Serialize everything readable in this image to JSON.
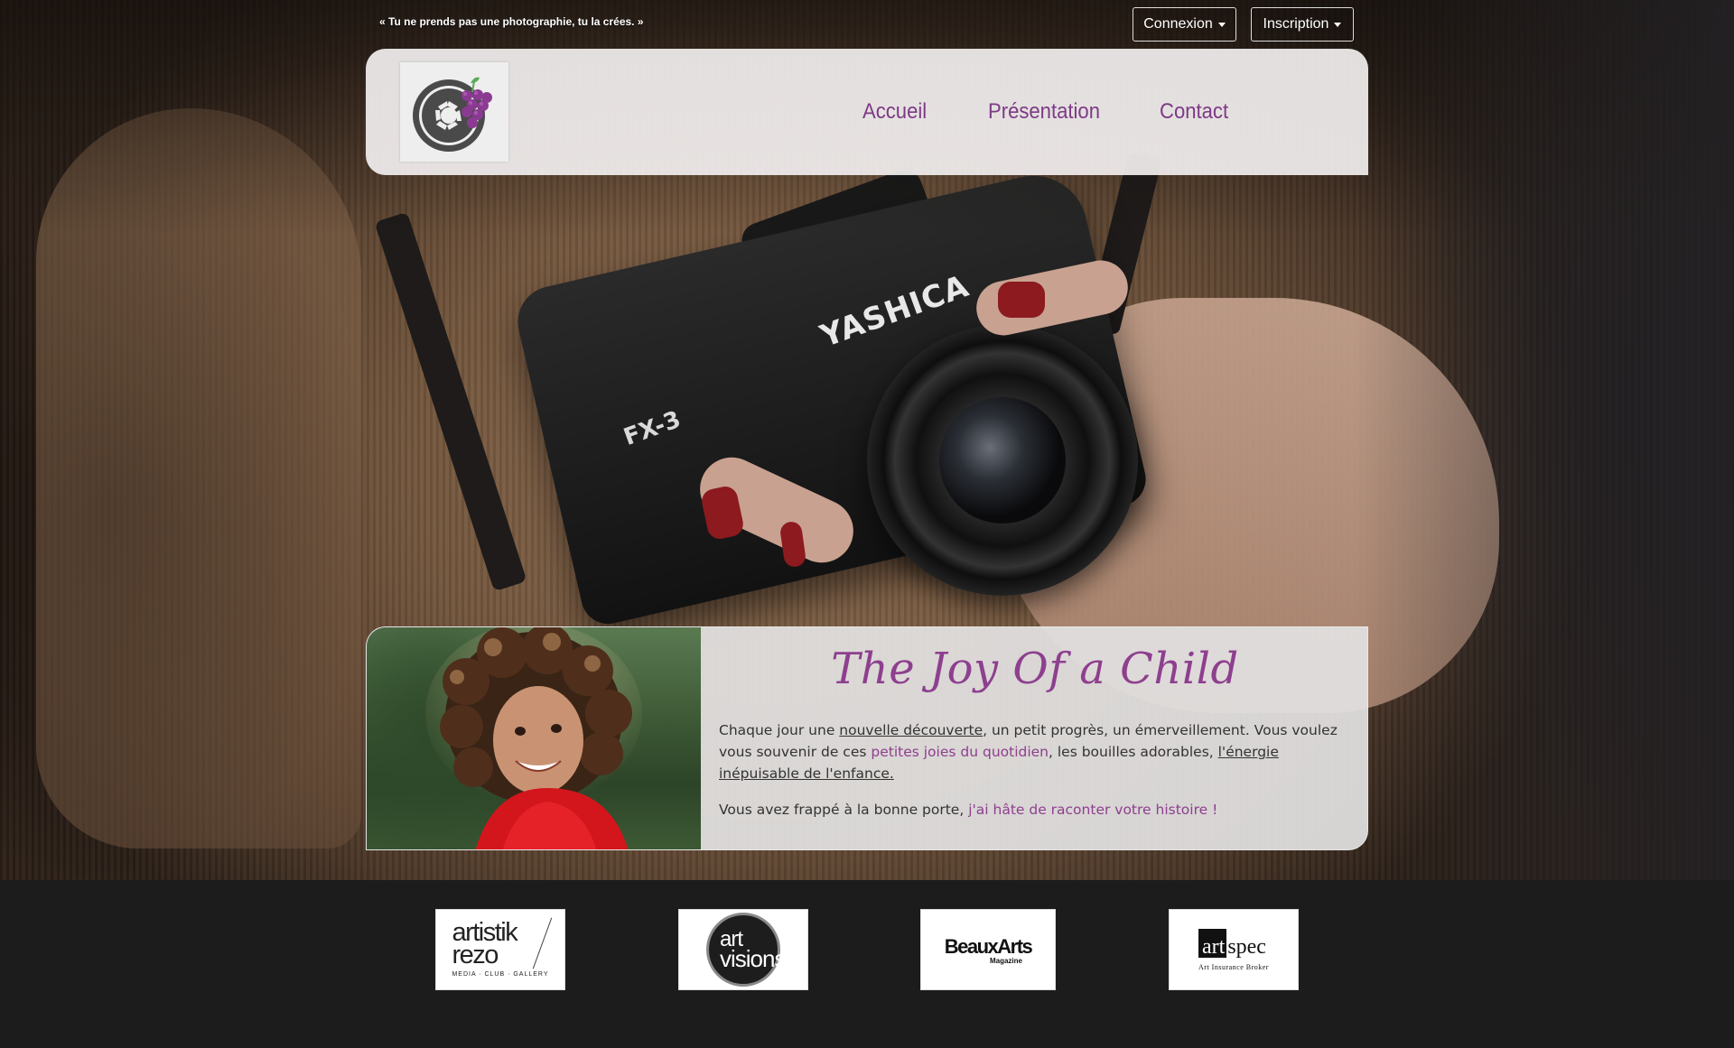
{
  "topbar": {
    "quote": "« Tu ne prends pas une photographie, tu la crées. »",
    "login_label": "Connexion",
    "signup_label": "Inscription"
  },
  "header": {
    "logo": "camera-aperture-grapes-logo",
    "nav": [
      "Accueil",
      "Présentation",
      "Contact"
    ]
  },
  "hero": {
    "camera_brand": "YASHICA",
    "camera_model": "FX-3"
  },
  "feature": {
    "title": "The Joy Of a Child",
    "p1_before": "Chaque jour une ",
    "p1_link1": "nouvelle découverte",
    "p1_mid1": ", un petit progrès, un émerveillement. Vous voulez vous souvenir de ces ",
    "p1_link2": "petites joies du quotidien",
    "p1_mid2": ", les bouilles adorables, ",
    "p1_link3": "l'énergie inépuisable de l'enfance.",
    "p2_before": "Vous avez frappé à la bonne porte, ",
    "p2_link": "j'ai hâte de raconter votre histoire !"
  },
  "partners": {
    "artistik": {
      "line1": "artistik",
      "line2": "rezo",
      "tagline": "MEDIA · CLUB · GALLERY"
    },
    "artvisions": {
      "line1": "art",
      "line2": "visions"
    },
    "beauxarts": {
      "name": "BeauxArts",
      "sub": "Magazine"
    },
    "artspec": {
      "boxed": "art",
      "rest": "spec",
      "sub": "Art Insurance Broker"
    }
  },
  "colors": {
    "accent_purple": "#7d3a86",
    "title_purple": "#8e3f8e",
    "footer_bg": "#1c1c1c"
  }
}
